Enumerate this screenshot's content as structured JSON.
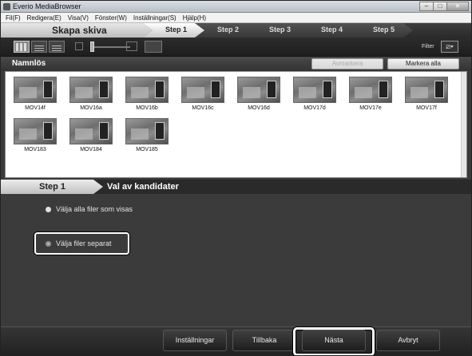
{
  "window": {
    "title": "Everio MediaBrowser",
    "buttons": {
      "minimize": "–",
      "maximize": "□",
      "close": "×"
    }
  },
  "menubar": {
    "items": [
      "Fil(F)",
      "Redigera(E)",
      "Visa(V)",
      "Fönster(W)",
      "Inställningar(S)",
      "Hjälp(H)"
    ]
  },
  "stepbar": {
    "title": "Skapa skiva",
    "steps": [
      "Step 1",
      "Step 2",
      "Step 3",
      "Step 4",
      "Step 5"
    ],
    "active_step_index": 0
  },
  "toolbar": {
    "filter_label": "Filter",
    "filter_icon": "filter-icon"
  },
  "namerow": {
    "name": "Namnlös",
    "deselect_label": "Avmarkera",
    "select_all_label": "Markera alla"
  },
  "thumbnails": [
    "MOV14f",
    "MOV16a",
    "MOV16b",
    "MOV16c",
    "MOV16d",
    "MOV17d",
    "MOV17e",
    "MOV17f",
    "MOV183",
    "MOV184",
    "MOV185"
  ],
  "step_section": {
    "step_label": "Step 1",
    "description": "Val av kandidater"
  },
  "options": {
    "all_files": "Välja alla filer som visas",
    "separate_files": "Välja filer separat",
    "selected": "separate_files"
  },
  "bottom": {
    "settings": "Inställningar",
    "back": "Tillbaka",
    "next": "Nästa",
    "cancel": "Avbryt"
  }
}
